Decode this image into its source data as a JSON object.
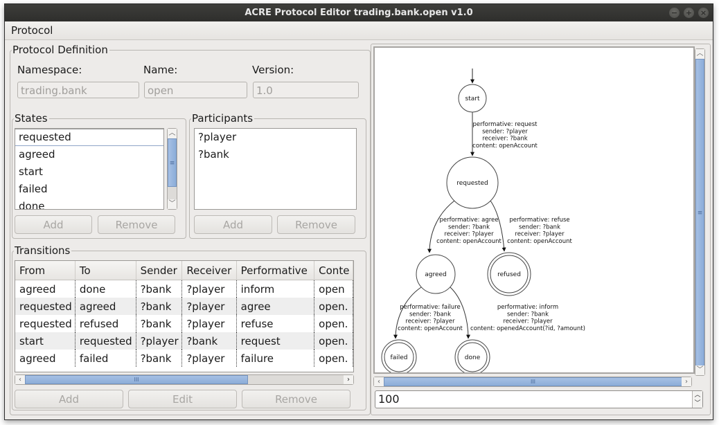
{
  "window": {
    "title": "ACRE Protocol Editor trading.bank.open v1.0",
    "controls": [
      "minimize",
      "maximize",
      "close"
    ]
  },
  "menubar": {
    "items": [
      {
        "label": "Protocol"
      }
    ]
  },
  "protocol_definition": {
    "title": "Protocol Definition",
    "namespace_label": "Namespace:",
    "name_label": "Name:",
    "version_label": "Version:",
    "namespace_value": "trading.bank",
    "name_value": "open",
    "version_value": "1.0"
  },
  "states": {
    "title": "States",
    "items": [
      "requested",
      "agreed",
      "start",
      "failed",
      "done"
    ],
    "selected": "requested",
    "add_label": "Add",
    "remove_label": "Remove"
  },
  "participants": {
    "title": "Participants",
    "items": [
      "?player",
      "?bank"
    ],
    "add_label": "Add",
    "remove_label": "Remove"
  },
  "transitions": {
    "title": "Transitions",
    "columns": [
      "From",
      "To",
      "Sender",
      "Receiver",
      "Performative",
      "Conte"
    ],
    "rows": [
      [
        "agreed",
        "done",
        "?bank",
        "?player",
        "inform",
        "open"
      ],
      [
        "requested",
        "agreed",
        "?bank",
        "?player",
        "agree",
        "open."
      ],
      [
        "requested",
        "refused",
        "?bank",
        "?player",
        "refuse",
        "open."
      ],
      [
        "start",
        "requested",
        "?player",
        "?bank",
        "request",
        "open."
      ],
      [
        "agreed",
        "failed",
        "?bank",
        "?player",
        "failure",
        "open."
      ]
    ],
    "add_label": "Add",
    "edit_label": "Edit",
    "remove_label": "Remove"
  },
  "diagram": {
    "nodes": [
      {
        "id": "start",
        "label": "start",
        "final": false
      },
      {
        "id": "requested",
        "label": "requested",
        "final": false
      },
      {
        "id": "agreed",
        "label": "agreed",
        "final": false
      },
      {
        "id": "refused",
        "label": "refused",
        "final": true
      },
      {
        "id": "failed",
        "label": "failed",
        "final": true
      },
      {
        "id": "done",
        "label": "done",
        "final": true
      }
    ],
    "edges": [
      {
        "from": "start",
        "to": "requested",
        "label": [
          "performative: request",
          "sender: ?player",
          "receiver: ?bank",
          "content: openAccount"
        ]
      },
      {
        "from": "requested",
        "to": "agreed",
        "label": [
          "performative: agree",
          "sender: ?bank",
          "receiver: ?player",
          "content: openAccount"
        ]
      },
      {
        "from": "requested",
        "to": "refused",
        "label": [
          "performative: refuse",
          "sender: ?bank",
          "receiver: ?player",
          "content: openAccount"
        ]
      },
      {
        "from": "agreed",
        "to": "failed",
        "label": [
          "performative: failure",
          "sender: ?bank",
          "receiver: ?player",
          "content: openAccount"
        ]
      },
      {
        "from": "agreed",
        "to": "done",
        "label": [
          "performative: inform",
          "sender: ?bank",
          "receiver: ?player",
          "content: openedAccount(?id, ?amount)"
        ]
      }
    ]
  },
  "zoom": {
    "value": "100"
  }
}
